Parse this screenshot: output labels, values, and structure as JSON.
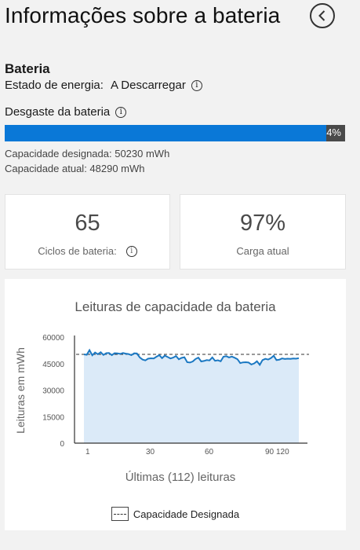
{
  "page": {
    "title": "Informações sobre a bateria"
  },
  "battery": {
    "section_title": "Bateria",
    "energy_state_label": "Estado de energia:",
    "energy_state_value": "A Descarregar",
    "wear_label": "Desgaste da bateria",
    "wear_percent_text": "4%",
    "wear_fraction": 0.04,
    "designed_capacity": "Capacidade designada:  50230  mWh",
    "current_capacity": "Capacidade atual:  48290  mWh"
  },
  "cards": {
    "cycles_value": "65",
    "cycles_label": "Ciclos de bateria:",
    "charge_value": "97%",
    "charge_label": "Carga atual"
  },
  "chart": {
    "title": "Leituras de capacidade da bateria",
    "legend_label": "Capacidade Designada"
  },
  "colors": {
    "accent": "#0a78d7",
    "line": "#1b78c2",
    "area": "#dbeaf8",
    "background": "#f2f2f2"
  },
  "chart_data": {
    "type": "area",
    "title": "Leituras de capacidade da bateria",
    "xlabel": "Últimas (112) leituras",
    "ylabel": "Leituras em mWh",
    "x_ticks": [
      "1",
      "30",
      "60",
      "90",
      "120"
    ],
    "y_ticks": [
      0,
      15000,
      30000,
      45000,
      60000
    ],
    "ylim": [
      0,
      60000
    ],
    "reference_line": {
      "name": "Capacidade Designada",
      "value": 50230
    },
    "series": [
      {
        "values": [
          50200,
          50000,
          52600,
          49700,
          51300,
          50300,
          51400,
          49900,
          50900,
          51000,
          49800,
          50900,
          50800,
          50500,
          51000,
          50600,
          50400,
          49800,
          50800,
          50700,
          48500,
          47300,
          46800,
          47800,
          48000,
          47900,
          48900,
          49800,
          48100,
          49500,
          48700,
          47900,
          48400,
          49300,
          47400,
          48200,
          48600,
          45800,
          45600,
          46200,
          47600,
          48400,
          46200,
          46500,
          47000,
          46800,
          48500,
          46600,
          46900,
          46300,
          48900,
          49200,
          48500,
          49000,
          48300,
          47500,
          45300,
          45700,
          45800,
          45600,
          44500,
          45100,
          46300,
          44300,
          47000,
          47700,
          47300,
          48100,
          49400,
          47000,
          47200,
          47900,
          47600,
          47800,
          47700,
          47900,
          47800,
          48100
        ]
      }
    ]
  }
}
